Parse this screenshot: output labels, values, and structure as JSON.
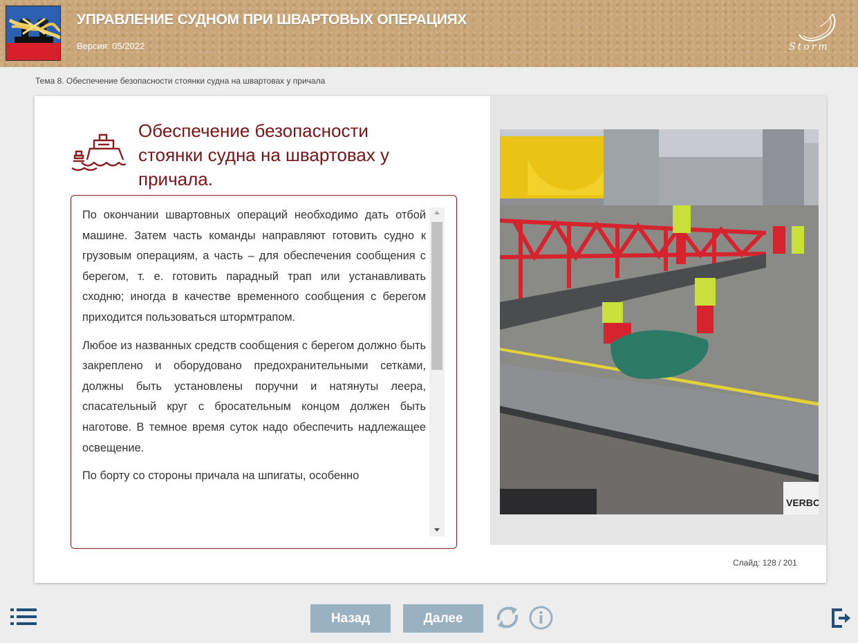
{
  "header": {
    "title": "УПРАВЛЕНИЕ СУДНОМ ПРИ ШВАРТОВЫХ ОПЕРАЦИЯХ",
    "version": "Версия: 05/2022",
    "brand": "Storm",
    "logo_icon": "bollard-mooring-logo",
    "brand_colors": {
      "header_bg": "#c9a577",
      "logo_blue": "#2b5fb0",
      "logo_red": "#d8202a"
    }
  },
  "breadcrumb": "Тема 8. Обеспечение безопасности стоянки судна на швартовах у причала",
  "slide": {
    "title": "Обеспечение безопасности стоянки судна на швартовах у причала.",
    "icon": "ship-icon",
    "accent_color": "#7a1416",
    "paragraphs": [
      "По окончании швартовных операций необходимо дать отбой машине. Затем часть команды направляют готовить судно к грузовым операциям, а часть – для обеспечения сообщения с берегом, т. е. готовить парадный трап или устанавливать сходню; иногда в качестве временного сообщения с берегом приходится пользоваться штормтрапом.",
      "Любое из названных средств сообщения с берегом должно быть закреплено и оборудовано предохранительными сетками, должны быть установлены поручни и натянуты леера, спасательный круг с бросательным концом должен быть наготове. В темное время суток надо обеспечить надлежащее освещение.",
      "По борту со стороны причала на шпигаты, особенно"
    ],
    "photo_label": "VERBO",
    "counter_label": "Слайд:",
    "counter_value": "128 / 201"
  },
  "footer": {
    "back_label": "Назад",
    "next_label": "Далее",
    "button_color": "#9ab1c2",
    "icons": [
      "menu-list-icon",
      "reload-icon",
      "info-icon",
      "exit-icon"
    ]
  }
}
